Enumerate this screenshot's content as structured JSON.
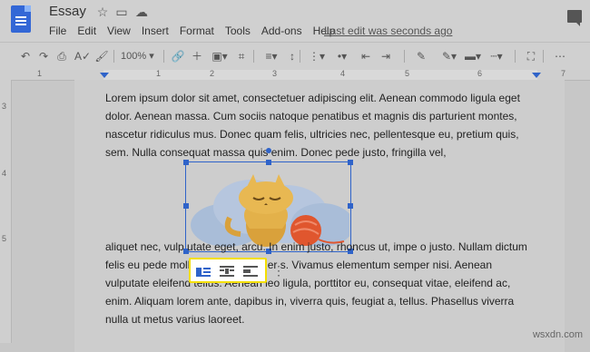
{
  "header": {
    "title": "Essay",
    "menu": [
      "File",
      "Edit",
      "View",
      "Insert",
      "Format",
      "Tools",
      "Add-ons",
      "Help"
    ],
    "last_edit": "Last edit was seconds ago"
  },
  "toolbar": {
    "zoom": "100%"
  },
  "ruler": {
    "top_numbers": [
      "1",
      "1",
      "2",
      "3",
      "4",
      "5",
      "6",
      "7"
    ],
    "left_numbers": [
      "3",
      "4",
      "5"
    ]
  },
  "document": {
    "paragraph1": "Lorem ipsum dolor sit amet, consectetuer adipiscing elit. Aenean commodo ligula eget dolor. Aenean massa. Cum sociis natoque penatibus et magnis dis parturient montes, nascetur ridiculus mus. Donec quam felis, ultricies nec, pellentesque eu, pretium quis, sem. Nulla consequat massa quis enim. Donec pede justo, fringilla vel,",
    "paragraph2": "aliquet nec, vulp                                                                    utate eget, arcu. In enim justo, rhoncus ut, impe                                                                    o justo. Nullam dictum felis eu pede mollis pretium. Integer                                                                    s. Vivamus elementum semper nisi. Aenean vulputate eleifend tellus. Aenean leo ligula, porttitor eu, consequat vitae, eleifend ac, enim. Aliquam lorem ante, dapibus in, viverra quis, feugiat a, tellus. Phasellus viverra nulla ut metus varius laoreet."
  },
  "image_toolbar": {
    "options": [
      "In line",
      "Wrap text",
      "Break text"
    ]
  },
  "watermark": "wsxdn.com"
}
